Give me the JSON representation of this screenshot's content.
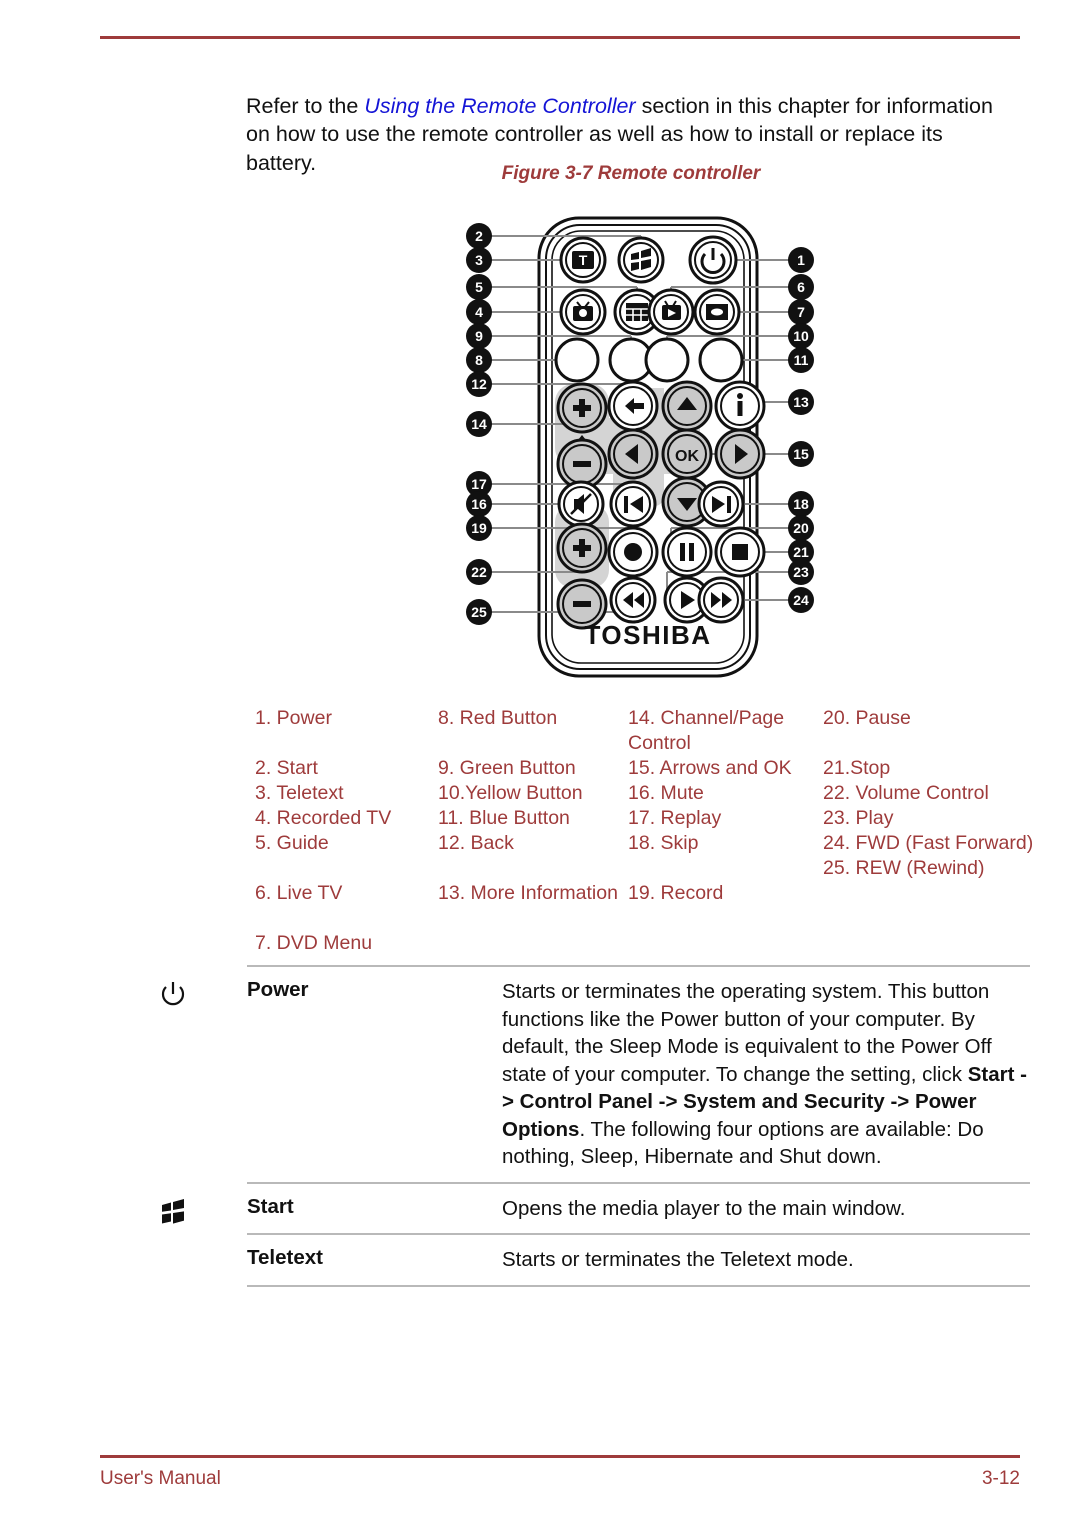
{
  "document": {
    "intro": {
      "before": "Refer to the ",
      "link": "Using the Remote Controller",
      "after": " section in this chapter for information on how to use the remote controller as well as how to install or replace its battery."
    },
    "figure_caption": "Figure 3-7 Remote controller",
    "brand": "TOSHIBA"
  },
  "legend": {
    "col1": [
      "1. Power",
      "2. Start",
      "3. Teletext",
      "4. Recorded TV",
      "5. Guide",
      "6. Live TV",
      "7. DVD Menu"
    ],
    "col2": [
      "8. Red Button",
      "9. Green Button",
      "10.Yellow Button",
      "11. Blue Button",
      "12. Back",
      "13. More Information"
    ],
    "col3": [
      "14. Channel/Page Control",
      "15. Arrows and OK",
      "16. Mute",
      "17. Replay",
      "18. Skip",
      "19. Record"
    ],
    "col4": [
      "20. Pause",
      "21.Stop",
      "22. Volume Control",
      "23. Play",
      "24. FWD (Fast Forward)",
      "25. REW (Rewind)"
    ]
  },
  "remote": {
    "callouts_left": [
      "2",
      "3",
      "5",
      "4",
      "9",
      "8",
      "12",
      "14",
      "17",
      "16",
      "19",
      "22",
      "25"
    ],
    "callouts_right": [
      "1",
      "6",
      "7",
      "10",
      "11",
      "13",
      "15",
      "18",
      "20",
      "21",
      "23",
      "24"
    ],
    "ok_label": "OK"
  },
  "table": {
    "rows": [
      {
        "icon": "power-icon",
        "name": "Power",
        "desc_parts": [
          {
            "text": "Starts or terminates the operating system. This button functions like the Power button of your computer. By default, the Sleep Mode is equivalent to the Power Off state of your computer. To change the setting, click ",
            "bold": false
          },
          {
            "text": "Start -> Control Panel -> System and Security -> Power Options",
            "bold": true
          },
          {
            "text": ". The following four options are available: Do nothing, Sleep, Hibernate and Shut down.",
            "bold": false
          }
        ]
      },
      {
        "icon": "windows-start-icon",
        "name": "Start",
        "desc_parts": [
          {
            "text": "Opens the media player to the main window.",
            "bold": false
          }
        ]
      },
      {
        "icon": "none",
        "name": "Teletext",
        "desc_parts": [
          {
            "text": "Starts or terminates the Teletext mode.",
            "bold": false
          }
        ]
      }
    ]
  },
  "footer": {
    "left": "User's Manual",
    "right": "3-12"
  },
  "colors": {
    "accent_red": "#9e3b3b",
    "link_blue": "#1414d6",
    "rule_gray": "#b9b9b9"
  }
}
